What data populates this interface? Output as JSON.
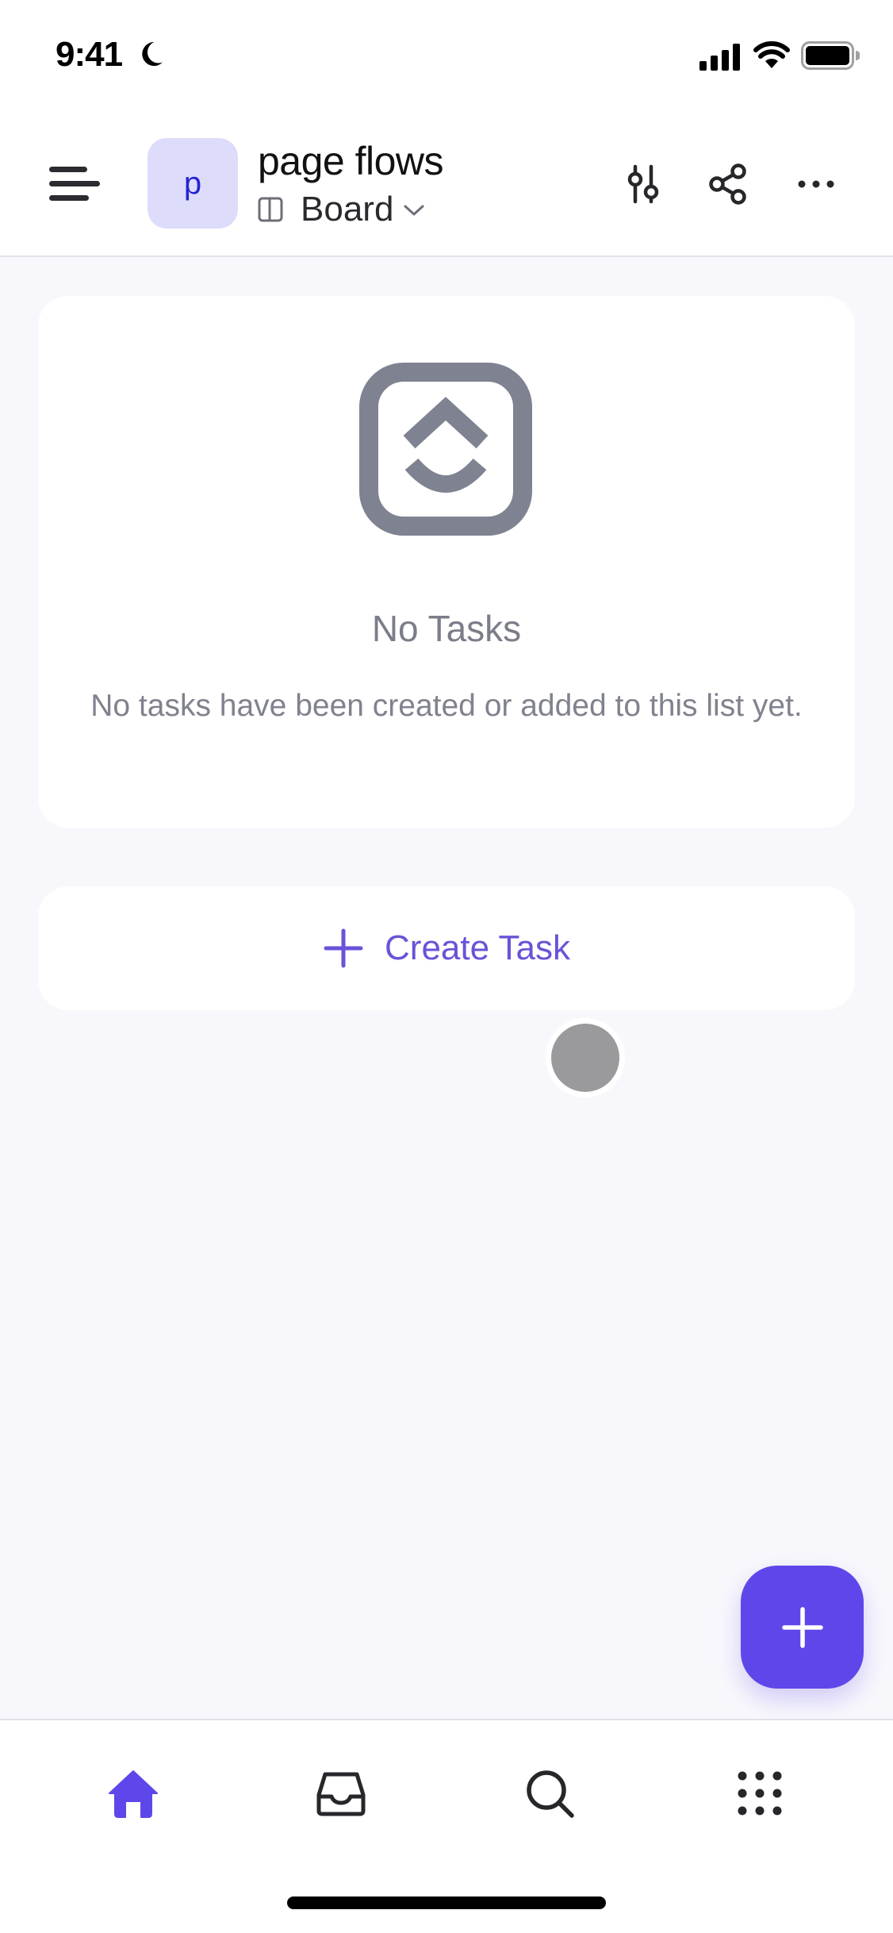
{
  "status_bar": {
    "time": "9:41",
    "icons": [
      "moon-icon",
      "cellular-signal-icon",
      "wifi-icon",
      "battery-icon"
    ]
  },
  "header": {
    "menu_icon": "hamburger-menu-icon",
    "space_avatar_letter": "p",
    "list_title": "page flows",
    "view": {
      "icon": "board-view-icon",
      "label": "Board",
      "dropdown_icon": "chevron-down-icon"
    },
    "actions": [
      {
        "name": "filter",
        "icon": "sliders-icon"
      },
      {
        "name": "share",
        "icon": "share-icon"
      },
      {
        "name": "more",
        "icon": "more-horizontal-icon"
      }
    ]
  },
  "empty_state": {
    "icon": "clickup-logo-icon",
    "title": "No Tasks",
    "description": "No tasks have been created or added to this list yet."
  },
  "create_task": {
    "icon": "plus-icon",
    "label": "Create Task"
  },
  "fab": {
    "icon": "plus-icon"
  },
  "tab_bar": {
    "items": [
      {
        "name": "home",
        "icon": "home-icon",
        "active": true
      },
      {
        "name": "inbox",
        "icon": "inbox-icon",
        "active": false
      },
      {
        "name": "search",
        "icon": "search-icon",
        "active": false
      },
      {
        "name": "more",
        "icon": "apps-grid-icon",
        "active": false
      }
    ]
  },
  "colors": {
    "accent": "#5e47ea",
    "accent_text": "#6b52d8",
    "avatar_bg": "#dedcfb",
    "avatar_text": "#2525d0",
    "muted_text": "#7b7d88",
    "page_bg": "#f8f8fc"
  }
}
